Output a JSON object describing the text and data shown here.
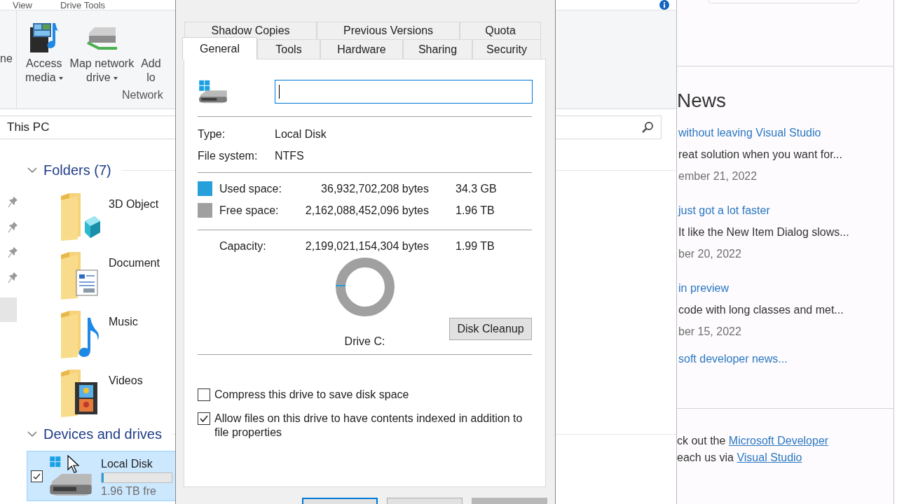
{
  "explorer": {
    "ribbon_tabs": [
      {
        "label": "View"
      },
      {
        "label": "Drive Tools"
      }
    ],
    "ribbon_commands": [
      {
        "kind": "partial",
        "lines": [
          "ne"
        ],
        "dropdown": false
      },
      {
        "kind": "media",
        "lines": [
          "Access",
          "media"
        ],
        "dropdown": true
      },
      {
        "kind": "network",
        "lines": [
          "Map network",
          "drive"
        ],
        "dropdown": true
      },
      {
        "kind": "location",
        "lines": [
          "Add",
          "lo"
        ],
        "dropdown": false
      }
    ],
    "ribbon_group": "Network",
    "address": "This PC",
    "sections": [
      {
        "title": "Folders (7)",
        "expanded": true,
        "items": [
          {
            "kind": "objects",
            "name": "3D Object"
          },
          {
            "kind": "documents",
            "name": "Document"
          },
          {
            "kind": "music",
            "name": "Music"
          },
          {
            "kind": "videos",
            "name": "Videos"
          }
        ]
      },
      {
        "title": "Devices and drives",
        "expanded": true,
        "items": [
          {
            "kind": "drive",
            "name": "Local Disk",
            "selected": true,
            "checked": true,
            "level": 0.03,
            "detail": "1.96 TB fre"
          }
        ]
      }
    ]
  },
  "dialog": {
    "tab_rows": [
      {
        "tabs": [
          {
            "label": "Shadow Copies",
            "selected": false
          },
          {
            "label": "Previous Versions",
            "selected": false
          },
          {
            "label": "Quota",
            "selected": false
          }
        ]
      },
      {
        "tabs": [
          {
            "label": "General",
            "selected": true
          },
          {
            "label": "Tools",
            "selected": false
          },
          {
            "label": "Hardware",
            "selected": false
          },
          {
            "label": "Sharing",
            "selected": false
          },
          {
            "label": "Security",
            "selected": false
          }
        ]
      }
    ],
    "name_field": {
      "focused": true
    },
    "fields": [
      {
        "label": "Type:",
        "value": "Local Disk"
      },
      {
        "label": "File system:",
        "value": "NTFS"
      }
    ],
    "space": [
      {
        "label": "Used space:",
        "bytes": "36,932,702,208 bytes",
        "size": "34.3 GB",
        "color": "#26a0da"
      },
      {
        "label": "Free space:",
        "bytes": "2,162,088,452,096 bytes",
        "size": "1.96 TB",
        "color": "#a0a0a0"
      }
    ],
    "capacity": {
      "label": "Capacity:",
      "bytes": "2,199,021,154,304 bytes",
      "size": "1.99 TB"
    },
    "drive_label": "Drive C:",
    "cleanup_button": "Disk Cleanup",
    "options": [
      {
        "label": "Compress this drive to save disk space",
        "checked": false
      },
      {
        "label": "Allow files on this drive to have contents indexed in addition to file properties",
        "checked": true
      }
    ],
    "footer_buttons": [
      {
        "default": true,
        "disabled": false
      },
      {
        "default": false,
        "disabled": false
      },
      {
        "default": false,
        "disabled": true
      }
    ]
  },
  "news": {
    "heading": "News",
    "items": [
      {
        "title": "without leaving Visual Studio",
        "summary": "reat solution when you want for...",
        "date": "ember 21, 2022"
      },
      {
        "title": "just got a lot faster",
        "summary": "It like the New Item Dialog slows...",
        "date": "ber 20, 2022"
      },
      {
        "title": "in preview",
        "summary": "code with long classes and met...",
        "date": "ber 15, 2022"
      }
    ],
    "more_link": "soft developer news...",
    "footer": [
      {
        "text": "ck out the",
        "link": "Microsoft Developer"
      },
      {
        "text": "each us via",
        "link": "Visual Studio"
      }
    ]
  }
}
